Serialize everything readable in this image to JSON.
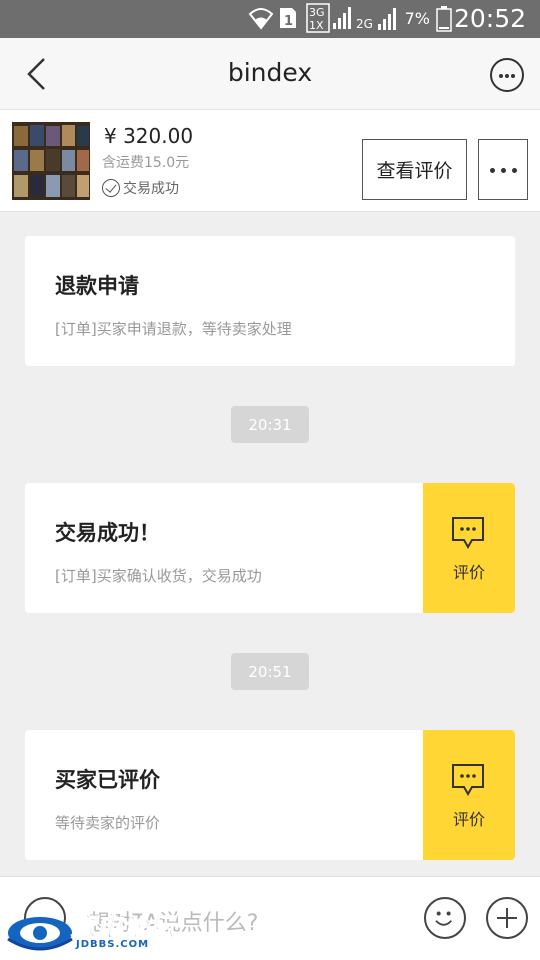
{
  "status_bar": {
    "time": "20:52",
    "battery": "7%",
    "network": "3G 1X 2G",
    "sim": "1"
  },
  "nav": {
    "title": "bindex",
    "back_icon": "chevron-left-icon",
    "more_icon": "ellipsis-circle-icon"
  },
  "product": {
    "price": "¥ 320.00",
    "shipping": "含运费15.0元",
    "status": "交易成功",
    "review_button": "查看评价",
    "more_icon": "ellipsis-icon"
  },
  "messages": [
    {
      "title": "退款申请",
      "subtitle": "[订单]买家申请退款，等待卖家处理"
    },
    {
      "timestamp": "20:31"
    },
    {
      "title": "交易成功！",
      "subtitle": "[订单]买家确认收货，交易成功",
      "action": "评价"
    },
    {
      "timestamp": "20:51"
    },
    {
      "title": "买家已评价",
      "subtitle": "等待卖家的评价",
      "action": "评价"
    }
  ],
  "input": {
    "placeholder": "想对TA说点什么?",
    "voice_icon": "voice-icon",
    "emoji_icon": "smiley-icon",
    "plus_icon": "plus-icon"
  },
  "watermark": {
    "text": "家电论坛",
    "sub": "JDBBS.COM"
  },
  "colors": {
    "accent": "#ffd633",
    "background": "#efefef",
    "status_bar": "#6e6e6e"
  }
}
